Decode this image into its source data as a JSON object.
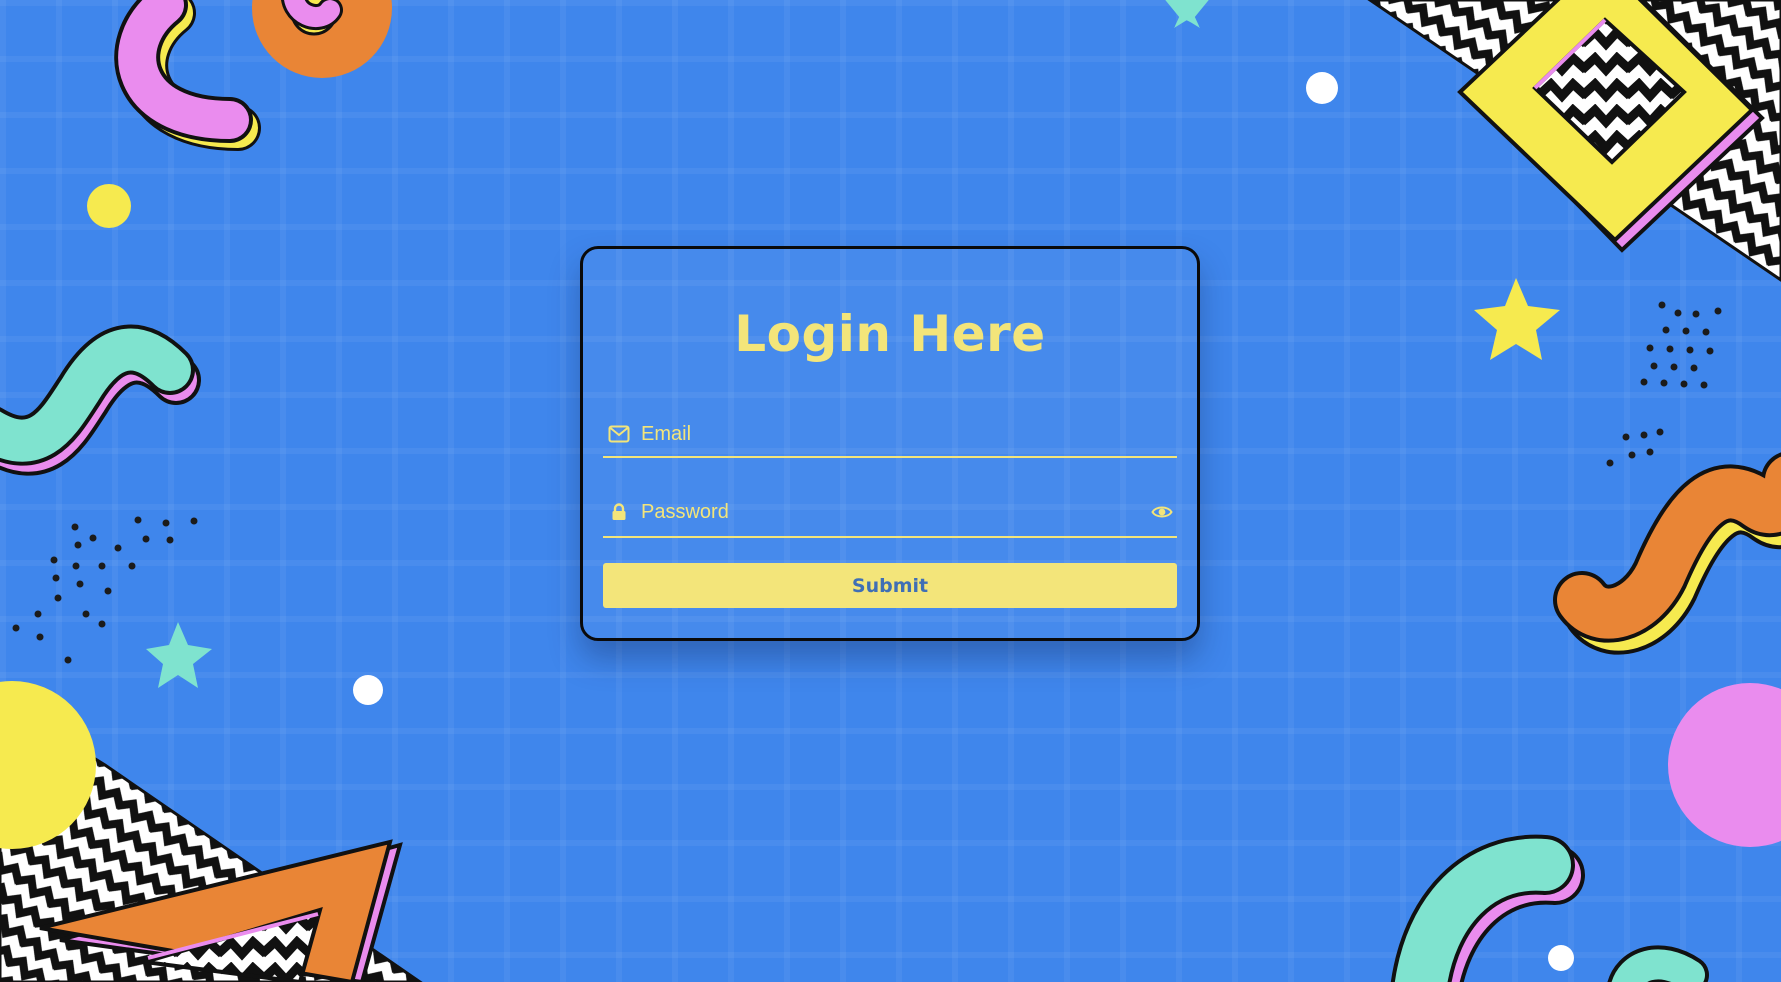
{
  "login": {
    "title": "Login Here",
    "email": {
      "placeholder": "Email",
      "value": "",
      "icon": "envelope-icon"
    },
    "password": {
      "placeholder": "Password",
      "value": "",
      "icon": "lock-icon",
      "toggle_icon": "eye-icon"
    },
    "submit_label": "Submit"
  },
  "colors": {
    "background": "#3f86ec",
    "accent_yellow": "#f3e57a",
    "button_text": "#3f6fb5",
    "card_border": "#0a0a0a",
    "decor_pink": "#ea8cee",
    "decor_orange": "#e98536",
    "decor_teal": "#7fe3cf",
    "decor_yellow": "#f6ea4f"
  }
}
